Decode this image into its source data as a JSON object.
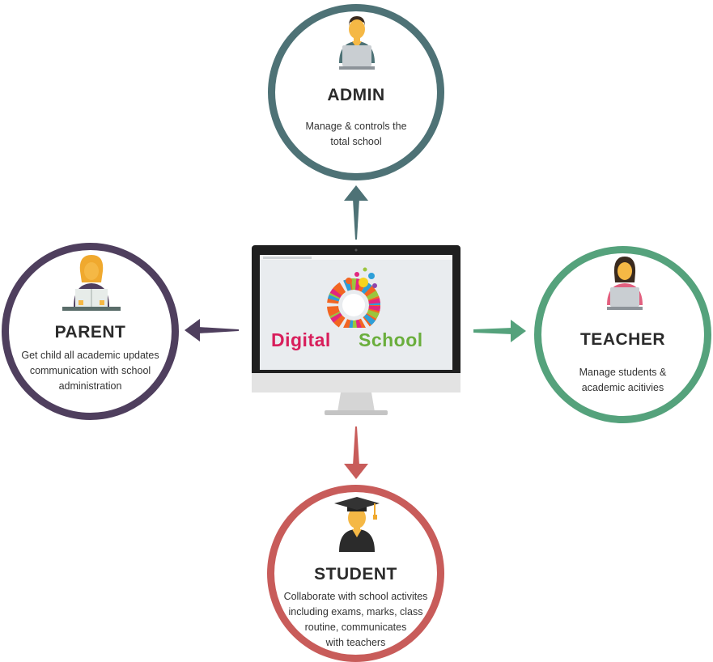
{
  "nodes": {
    "admin": {
      "title": "ADMIN",
      "desc": "Manage & controls the\ntotal school",
      "color": "#4e7276"
    },
    "parent": {
      "title": "PARENT",
      "desc": "Get child all academic updates\ncommunication with school\nadministration",
      "color": "#4f3f5e"
    },
    "teacher": {
      "title": "TEACHER",
      "desc": "Manage students &\nacademic acitivies",
      "color": "#55a27c"
    },
    "student": {
      "title": "STUDENT",
      "desc": "Collaborate with school activites\nincluding exams, marks, class\nroutine, communicates\nwith teachers",
      "color": "#c85c5a"
    }
  },
  "center": {
    "logo_word_1": "Digital",
    "logo_word_2": "School",
    "logo_color_1": "#d81e5b",
    "logo_color_2": "#6aae3c"
  },
  "icons": {
    "admin": "admin-laptop-user-icon",
    "parent": "parent-reading-icon",
    "teacher": "teacher-laptop-user-icon",
    "student": "graduate-student-icon"
  }
}
